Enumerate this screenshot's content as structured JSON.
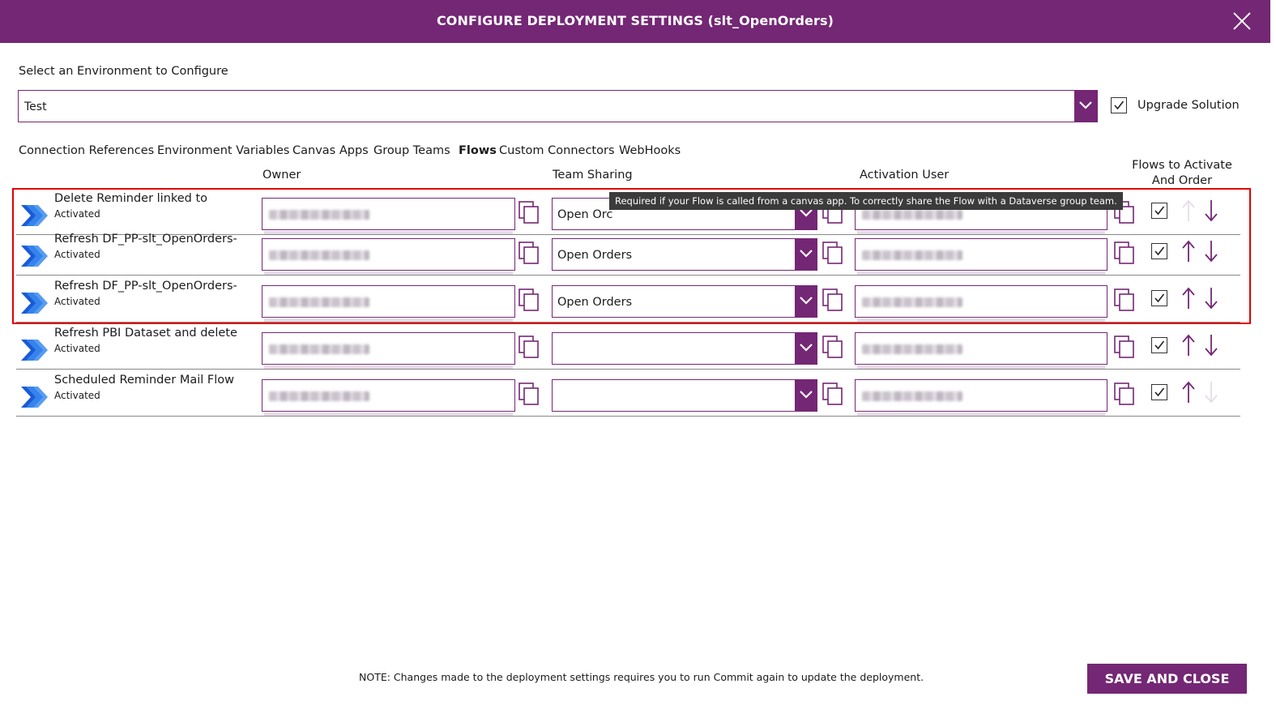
{
  "dialog": {
    "title": "CONFIGURE DEPLOYMENT SETTINGS (slt_OpenOrders)",
    "close_icon": "close-icon"
  },
  "environment": {
    "label": "Select an Environment to Configure",
    "selected": "Test",
    "upgrade_label": "Upgrade Solution",
    "upgrade_checked": true
  },
  "tabs": [
    {
      "label": "Connection References",
      "active": false
    },
    {
      "label": "Environment Variables",
      "active": false
    },
    {
      "label": "Canvas Apps",
      "active": false
    },
    {
      "label": "Group Teams",
      "active": false
    },
    {
      "label": "Flows",
      "active": true
    },
    {
      "label": "Custom Connectors",
      "active": false
    },
    {
      "label": "WebHooks",
      "active": false
    }
  ],
  "columns": {
    "owner": "Owner",
    "team_sharing": "Team Sharing",
    "activation_user": "Activation User",
    "flows_order": "Flows to Activate And Order"
  },
  "flows": [
    {
      "name": "Delete Reminder linked to",
      "status": "Activated",
      "team": "Open Orc",
      "activate": true,
      "up_enabled": false,
      "down_enabled": true
    },
    {
      "name": "Refresh DF_PP-slt_OpenOrders-",
      "status": "Activated",
      "team": "Open Orders",
      "activate": true,
      "up_enabled": true,
      "down_enabled": true
    },
    {
      "name": "Refresh DF_PP-slt_OpenOrders-",
      "status": "Activated",
      "team": "Open Orders",
      "activate": true,
      "up_enabled": true,
      "down_enabled": true
    },
    {
      "name": "Refresh PBI Dataset and delete",
      "status": "Activated",
      "team": "",
      "activate": true,
      "up_enabled": true,
      "down_enabled": true
    },
    {
      "name": "Scheduled Reminder Mail Flow",
      "status": "Activated",
      "team": "",
      "activate": true,
      "up_enabled": true,
      "down_enabled": false
    }
  ],
  "tooltip": "Required if your Flow is called from a canvas app. To correctly share the Flow with a Dataverse group team.",
  "footer": {
    "note": "NOTE: Changes made to the deployment settings requires you to run Commit again to update the deployment.",
    "save_label": "SAVE AND CLOSE"
  },
  "colors": {
    "accent": "#742774",
    "highlight": "#e00000",
    "flow_icon": "#2266e3"
  }
}
